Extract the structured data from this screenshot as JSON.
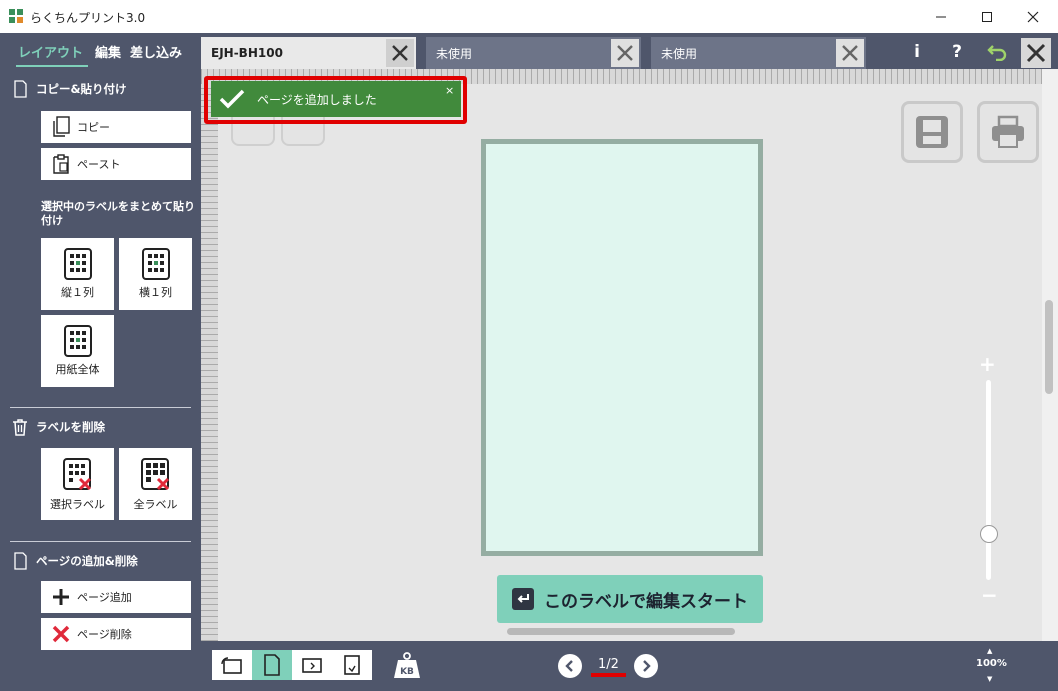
{
  "window": {
    "title": "らくちんプリント3.0",
    "controls": {
      "minimize": "—",
      "maximize": "☐",
      "close": "✕"
    }
  },
  "sidebar": {
    "tabs": [
      {
        "label": "レイアウト",
        "active": true
      },
      {
        "label": "編集",
        "active": false
      },
      {
        "label": "差し込み",
        "active": false
      }
    ],
    "copy_paste": {
      "heading": "コピー&貼り付け",
      "copy_label": "コピー",
      "paste_label": "ペースト",
      "bulk_heading": "選択中のラベルをまとめて貼り付け",
      "tiles": [
        "縦１列",
        "横１列",
        "用紙全体"
      ]
    },
    "delete": {
      "heading": "ラベルを削除",
      "tiles": [
        "選択ラベル",
        "全ラベル"
      ]
    },
    "pages": {
      "heading": "ページの追加&削除",
      "add_label": "ページ追加",
      "delete_label": "ページ削除"
    }
  },
  "tabs": [
    {
      "label": "EJH-BH100",
      "active": true
    },
    {
      "label": "未使用",
      "active": false
    },
    {
      "label": "未使用",
      "active": false
    }
  ],
  "toolbar": {
    "info": "i",
    "help": "?"
  },
  "toast": {
    "message": "ページを追加しました",
    "close": "×"
  },
  "canvas": {
    "start_button": "このラベルで編集スタート"
  },
  "zoom": {
    "plus": "+",
    "minus": "−",
    "level_text": "100%"
  },
  "pager": {
    "current": 1,
    "total": 2,
    "text": "1/2"
  },
  "colors": {
    "sidebar_bg": "#4f566b",
    "accent": "#7fd0ba",
    "toast_bg": "#418a3c",
    "highlight": "#e00000",
    "paper": "#e0f6ef"
  }
}
